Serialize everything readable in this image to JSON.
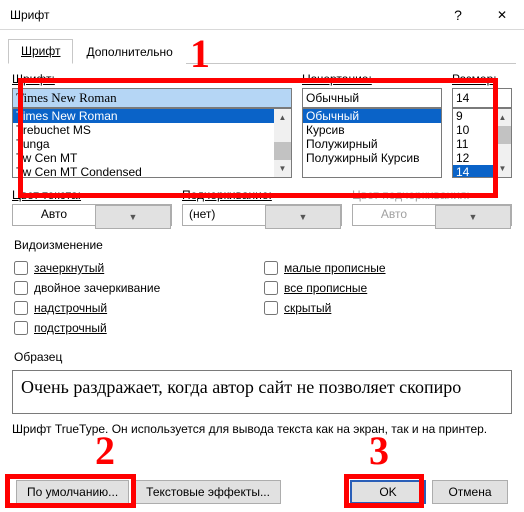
{
  "window": {
    "title": "Шрифт",
    "help": "?",
    "close": "✕"
  },
  "tabs": {
    "tab1": "Шрифт",
    "tab2": "Дополнительно"
  },
  "labels": {
    "font": "Шрифт:",
    "style": "Начертание:",
    "size": "Размер:",
    "color": "Цвет текста:",
    "underline": "Подчеркивание:",
    "ulcolor": "Цвет подчеркивания:",
    "effects": "Видоизменение",
    "sample": "Образец"
  },
  "font": {
    "value": "Times New Roman",
    "list": [
      "Times New Roman",
      "Trebuchet MS",
      "Tunga",
      "Tw Cen MT",
      "Tw Cen MT Condensed"
    ]
  },
  "style": {
    "value": "Обычный",
    "list": [
      "Обычный",
      "Курсив",
      "Полужирный",
      "Полужирный Курсив"
    ]
  },
  "size": {
    "value": "14",
    "list": [
      "9",
      "10",
      "11",
      "12",
      "14"
    ]
  },
  "row2": {
    "color": "Авто",
    "underline": "(нет)",
    "ulcolor": "Авто"
  },
  "checks": {
    "c1": "зачеркнутый",
    "c2": "двойное зачеркивание",
    "c3": "надстрочный",
    "c4": "подстрочный",
    "c5": "малые прописные",
    "c6": "все прописные",
    "c7": "скрытый"
  },
  "preview_text": "Очень раздражает, когда автор сайт не позволяет скопиро",
  "note": "Шрифт TrueType. Он используется для вывода текста как на экран, так и на принтер.",
  "buttons": {
    "default": "По умолчанию...",
    "textfx": "Текстовые эффекты...",
    "ok": "OK",
    "cancel": "Отмена"
  },
  "annotations": {
    "n1": "1",
    "n2": "2",
    "n3": "3"
  }
}
